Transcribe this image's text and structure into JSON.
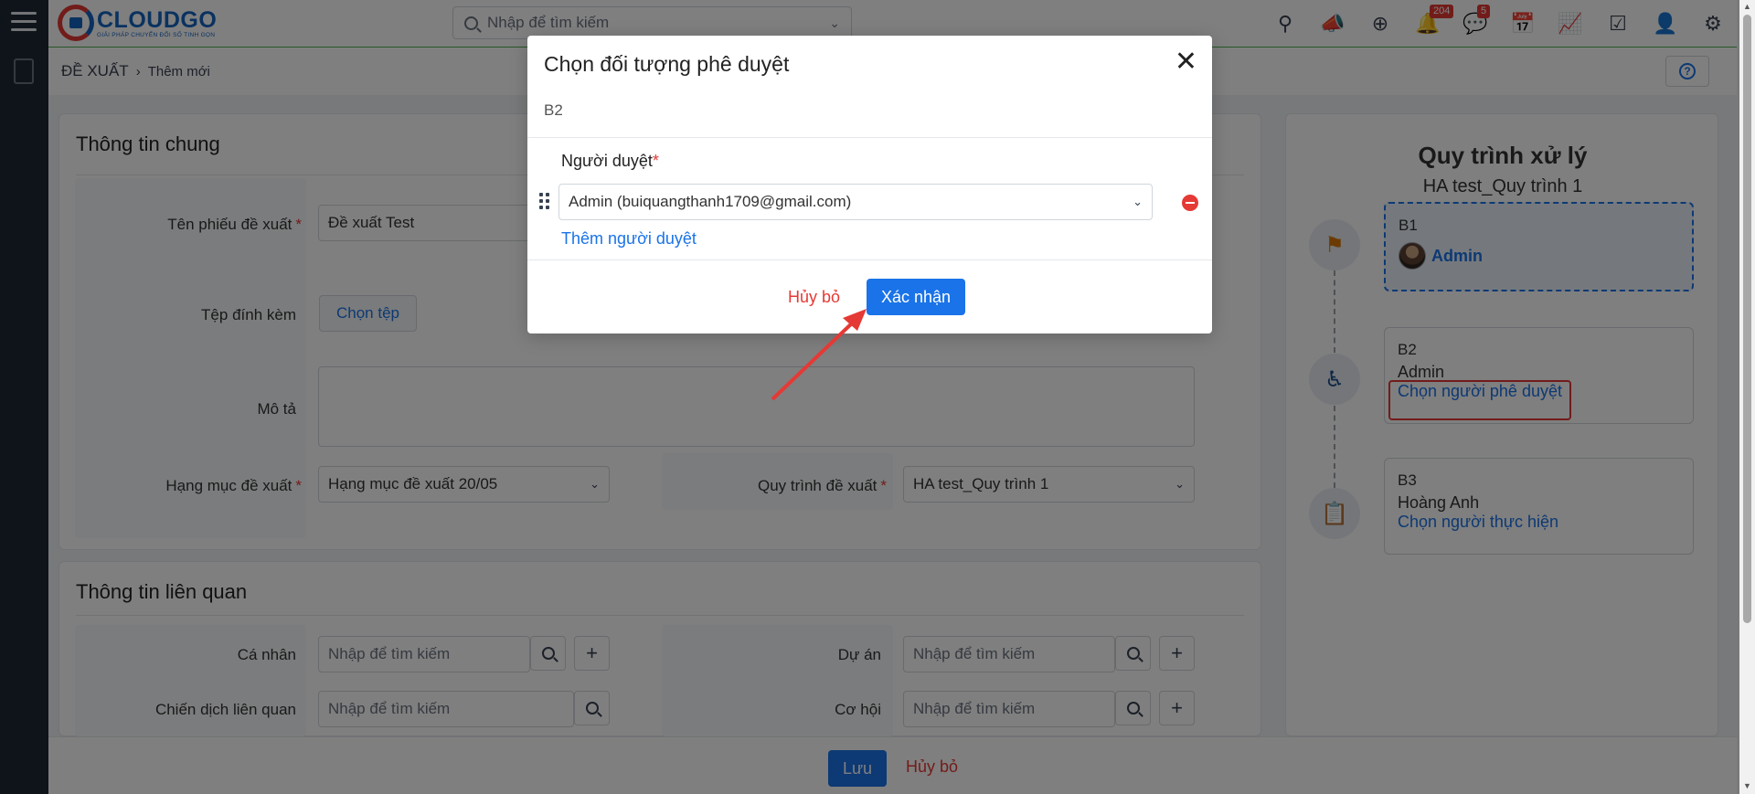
{
  "app": {
    "brand": "CLOUDGO",
    "tagline": "GIẢI PHÁP CHUYỂN ĐỔI SỐ TINH GỌN",
    "search_placeholder": "Nhập để tìm kiếm",
    "notifications_count": "204",
    "messages_count": "5",
    "icons": [
      "location-icon",
      "megaphone-icon",
      "plus-circle-icon",
      "bell-icon",
      "chat-icon",
      "calendar-icon",
      "chart-icon",
      "checkbox-icon",
      "user-icon",
      "gear-icon"
    ]
  },
  "breadcrumb": {
    "root": "ĐỀ XUẤT",
    "current": "Thêm mới"
  },
  "general": {
    "title": "Thông tin chung",
    "name_label": "Tên phiếu đề xuất",
    "name_value": "Đề xuất Test",
    "attach_label": "Tệp đính kèm",
    "attach_button": "Chọn tệp",
    "desc_label": "Mô tả",
    "category_label": "Hạng mục đề xuất",
    "category_value": "Hạng mục đề xuất 20/05",
    "process_label": "Quy trình đề xuất",
    "process_value": "HA test_Quy trình 1"
  },
  "related": {
    "title": "Thông tin liên quan",
    "person_label": "Cá nhân",
    "project_label": "Dự án",
    "campaign_label": "Chiến dịch liên quan",
    "opportunity_label": "Cơ hội",
    "placeholder": "Nhập để tìm kiếm"
  },
  "flow": {
    "title": "Quy trình xử lý",
    "subtitle": "HA test_Quy trình 1",
    "steps": [
      {
        "code": "B1",
        "who": "Admin",
        "link": ""
      },
      {
        "code": "B2",
        "who": "Admin",
        "link": "Chọn người phê duyệt"
      },
      {
        "code": "B3",
        "who": "Hoàng Anh",
        "link": "Chọn người thực hiện"
      }
    ]
  },
  "footer": {
    "save": "Lưu",
    "cancel": "Hủy bỏ"
  },
  "modal": {
    "title": "Chọn đối tượng phê duyệt",
    "close": "✕",
    "step": "B2",
    "approver_label": "Người duyệt",
    "approver_value": "Admin (buiquangthanh1709@gmail.com)",
    "add_link": "Thêm người duyệt",
    "cancel": "Hủy bỏ",
    "confirm": "Xác nhận"
  },
  "colors": {
    "accent": "#1a73e8",
    "danger": "#e53935",
    "rail": "#1f2937"
  }
}
